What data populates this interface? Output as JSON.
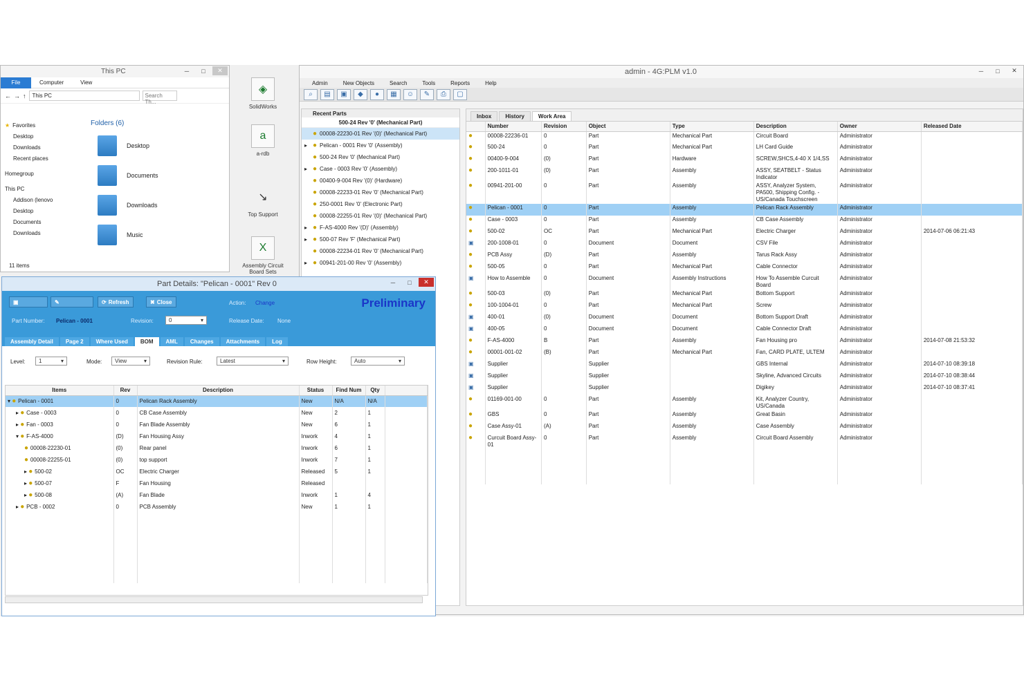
{
  "explorer": {
    "title": "This PC",
    "tabs": [
      "File",
      "Computer",
      "View"
    ],
    "address": "This PC",
    "search_placeholder": "Search Th...",
    "nav": [
      "Favorites",
      "Desktop",
      "Downloads",
      "Recent places",
      "Homegroup",
      "This PC",
      "Addison (lenovo",
      "Desktop",
      "Documents",
      "Downloads",
      "Music"
    ],
    "folders_header": "Folders (6)",
    "folders": [
      "Desktop",
      "Documents",
      "Downloads",
      "Music"
    ],
    "count": "11 items"
  },
  "desktop": {
    "icons": [
      "SolidWorks",
      "a-rdb",
      "Top Support",
      "Assembly Circuit Board Sets"
    ]
  },
  "plm": {
    "title": "admin - 4G:PLM v1.0",
    "menus": [
      "Admin",
      "New Objects",
      "Search",
      "Tools",
      "Reports",
      "Help"
    ],
    "recent_header": "Recent Parts",
    "recent_title": "500-24 Rev '0' (Mechanical Part)",
    "recent": [
      "00008-22230-01 Rev '(0)' (Mechanical Part)",
      "Pelican - 0001 Rev '0' (Assembly)",
      "500-24 Rev '0' (Mechanical Part)",
      "Case - 0003 Rev '0' (Assembly)",
      "00400-9-004 Rev '(0)' (Hardware)",
      "00008-22233-01 Rev '0' (Mechanical Part)",
      "250-0001 Rev '0' (Electronic Part)",
      "00008-22255-01 Rev '(0)' (Mechanical Part)",
      "F-AS-4000 Rev '(D)' (Assembly)",
      "500-07 Rev 'F' (Mechanical Part)",
      "00008-22234-01 Rev '0' (Mechanical Part)",
      "00941-201-00 Rev '0' (Assembly)"
    ],
    "tabs": [
      "Inbox",
      "History",
      "Work Area"
    ],
    "columns": [
      "Number",
      "Revision",
      "Object",
      "Type",
      "Description",
      "Owner",
      "Released Date"
    ],
    "rows": [
      [
        "00008-22236-01",
        "0",
        "Part",
        "Mechanical Part",
        "Circuit Board",
        "Administrator",
        ""
      ],
      [
        "500-24",
        "0",
        "Part",
        "Mechanical Part",
        "LH Card Guide",
        "Administrator",
        ""
      ],
      [
        "00400-9-004",
        "(0)",
        "Part",
        "Hardware",
        "SCREW,SHCS,4-40 X 1/4,SS",
        "Administrator",
        ""
      ],
      [
        "200-1011-01",
        "(0)",
        "Part",
        "Assembly",
        "ASSY, SEATBELT - Status Indicator",
        "Administrator",
        ""
      ],
      [
        "00941-201-00",
        "0",
        "Part",
        "Assembly",
        "ASSY, Analyzer System, PA500, Shipping Config. - US/Canada Touchscreen",
        "Administrator",
        ""
      ],
      [
        "Pelican - 0001",
        "0",
        "Part",
        "Assembly",
        "Pelican Rack Assembly",
        "Administrator",
        ""
      ],
      [
        "Case - 0003",
        "0",
        "Part",
        "Assembly",
        "CB Case Assembly",
        "Administrator",
        ""
      ],
      [
        "500-02",
        "OC",
        "Part",
        "Mechanical Part",
        "Electric Charger",
        "Administrator",
        "2014-07-06 06:21:43"
      ],
      [
        "200-1008-01",
        "0",
        "Document",
        "Document",
        "CSV File",
        "Administrator",
        ""
      ],
      [
        "PCB Assy",
        "(D)",
        "Part",
        "Assembly",
        "Tarus Rack Assy",
        "Administrator",
        ""
      ],
      [
        "500-05",
        "0",
        "Part",
        "Mechanical Part",
        "Cable Connector",
        "Administrator",
        ""
      ],
      [
        "How to Assemble",
        "0",
        "Document",
        "Assembly Instructions",
        "How To Assemble Curcuit Board",
        "Administrator",
        ""
      ],
      [
        "500-03",
        "(0)",
        "Part",
        "Mechanical Part",
        "Bottom Support",
        "Administrator",
        ""
      ],
      [
        "100-1004-01",
        "0",
        "Part",
        "Mechanical Part",
        "Screw",
        "Administrator",
        ""
      ],
      [
        "400-01",
        "(0)",
        "Document",
        "Document",
        "Bottom Support Draft",
        "Administrator",
        ""
      ],
      [
        "400-05",
        "0",
        "Document",
        "Document",
        "Cable Connector Draft",
        "Administrator",
        ""
      ],
      [
        "F-AS-4000",
        "B",
        "Part",
        "Assembly",
        "Fan Housing pro",
        "Administrator",
        "2014-07-08 21:53:32"
      ],
      [
        "00001-001-02",
        "(B)",
        "Part",
        "Mechanical Part",
        "Fan, CARD PLATE, ULTEM",
        "Administrator",
        ""
      ],
      [
        "Supplier",
        "",
        "Supplier",
        "",
        "GBS Internal",
        "Administrator",
        "2014-07-10 08:39:18"
      ],
      [
        "Supplier",
        "",
        "Supplier",
        "",
        "Skyline, Advanced Circuits",
        "Administrator",
        "2014-07-10 08:38:44"
      ],
      [
        "Supplier",
        "",
        "Supplier",
        "",
        "Digikey",
        "Administrator",
        "2014-07-10 08:37:41"
      ],
      [
        "01169-001-00",
        "0",
        "Part",
        "Assembly",
        "Kit, Analyzer Country, US/Canada",
        "Administrator",
        ""
      ],
      [
        "GBS",
        "0",
        "Part",
        "Assembly",
        "Great Basin",
        "Administrator",
        ""
      ],
      [
        "Case Assy-01",
        "(A)",
        "Part",
        "Assembly",
        "Case Assembly",
        "Administrator",
        ""
      ],
      [
        "Curcuit Board Assy-01",
        "0",
        "Part",
        "Assembly",
        "Circuit Board Assembly",
        "Administrator",
        ""
      ]
    ]
  },
  "dialog": {
    "title": "Part Details: \"Pelican - 0001\" Rev 0",
    "refresh": "Refresh",
    "close": "Close",
    "action_label": "Action:",
    "action": "Change",
    "status": "Preliminary",
    "part_number_label": "Part Number:",
    "part_number": "Pelican - 0001",
    "revision_label": "Revision:",
    "revision": "0",
    "release_label": "Release Date:",
    "release": "None",
    "tabs": [
      "Assembly Detail",
      "Page 2",
      "Where Used",
      "BOM",
      "AML",
      "Changes",
      "Attachments",
      "Log"
    ],
    "level_label": "Level:",
    "level": "1",
    "mode_label": "Mode:",
    "mode": "View",
    "rules_label": "Revision Rule:",
    "rules": "Latest",
    "row_label": "Row Height:",
    "row": "Auto",
    "columns": [
      "Items",
      "Rev",
      "Description",
      "Status",
      "Find Num",
      "Qty"
    ],
    "rows": [
      [
        "Pelican - 0001",
        "0",
        "Pelican Rack Assembly",
        "New",
        "N/A",
        "N/A"
      ],
      [
        "Case - 0003",
        "0",
        "CB Case Assembly",
        "New",
        "2",
        "1"
      ],
      [
        "Fan - 0003",
        "0",
        "Fan Blade Assembly",
        "New",
        "6",
        "1"
      ],
      [
        "F-AS-4000",
        "(D)",
        "Fan Housing Assy",
        "Inwork",
        "4",
        "1"
      ],
      [
        "00008-22230-01",
        "(0)",
        "Rear panel",
        "Inwork",
        "6",
        "1"
      ],
      [
        "00008-22255-01",
        "(0)",
        "top support",
        "Inwork",
        "7",
        "1"
      ],
      [
        "500-02",
        "OC",
        "Electric Charger",
        "Released",
        "5",
        "1"
      ],
      [
        "500-07",
        "F",
        "Fan Housing",
        "Released",
        "",
        ""
      ],
      [
        "500-08",
        "(A)",
        "Fan Blade",
        "Inwork",
        "1",
        "4"
      ],
      [
        "PCB - 0002",
        "0",
        "PCB Assembly",
        "New",
        "1",
        "1"
      ]
    ]
  }
}
